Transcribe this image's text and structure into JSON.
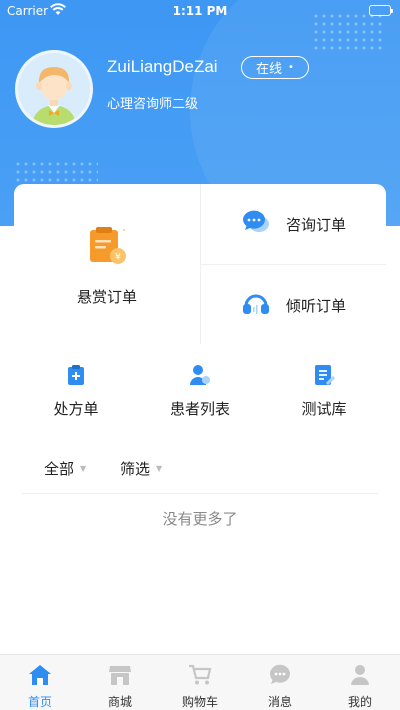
{
  "status_bar": {
    "carrier": "Carrier",
    "time": "1:11 PM"
  },
  "profile": {
    "username": "ZuiLiangDeZai",
    "status_label": "在线",
    "status_dot": "•",
    "role": "心理咨询师二级"
  },
  "orders": {
    "reward_label": "悬赏订单",
    "consult_label": "咨询订单",
    "listen_label": "倾听订单"
  },
  "quick_links": [
    {
      "label": "处方单",
      "icon": "prescription-icon"
    },
    {
      "label": "患者列表",
      "icon": "patient-icon"
    },
    {
      "label": "测试库",
      "icon": "test-library-icon"
    }
  ],
  "filters": {
    "all_label": "全部",
    "filter_label": "筛选",
    "caret": "▼"
  },
  "empty_text": "没有更多了",
  "tabbar": [
    {
      "label": "首页",
      "icon": "home-icon",
      "active": true
    },
    {
      "label": "商城",
      "icon": "store-icon",
      "active": false
    },
    {
      "label": "购物车",
      "icon": "cart-icon",
      "active": false
    },
    {
      "label": "消息",
      "icon": "message-icon",
      "active": false
    },
    {
      "label": "我的",
      "icon": "profile-icon",
      "active": false
    }
  ],
  "colors": {
    "primary": "#3d97f3",
    "active_tab": "#2f8cf0",
    "orange": "#f59a2b",
    "inactive_icon": "#c6c6c6"
  }
}
